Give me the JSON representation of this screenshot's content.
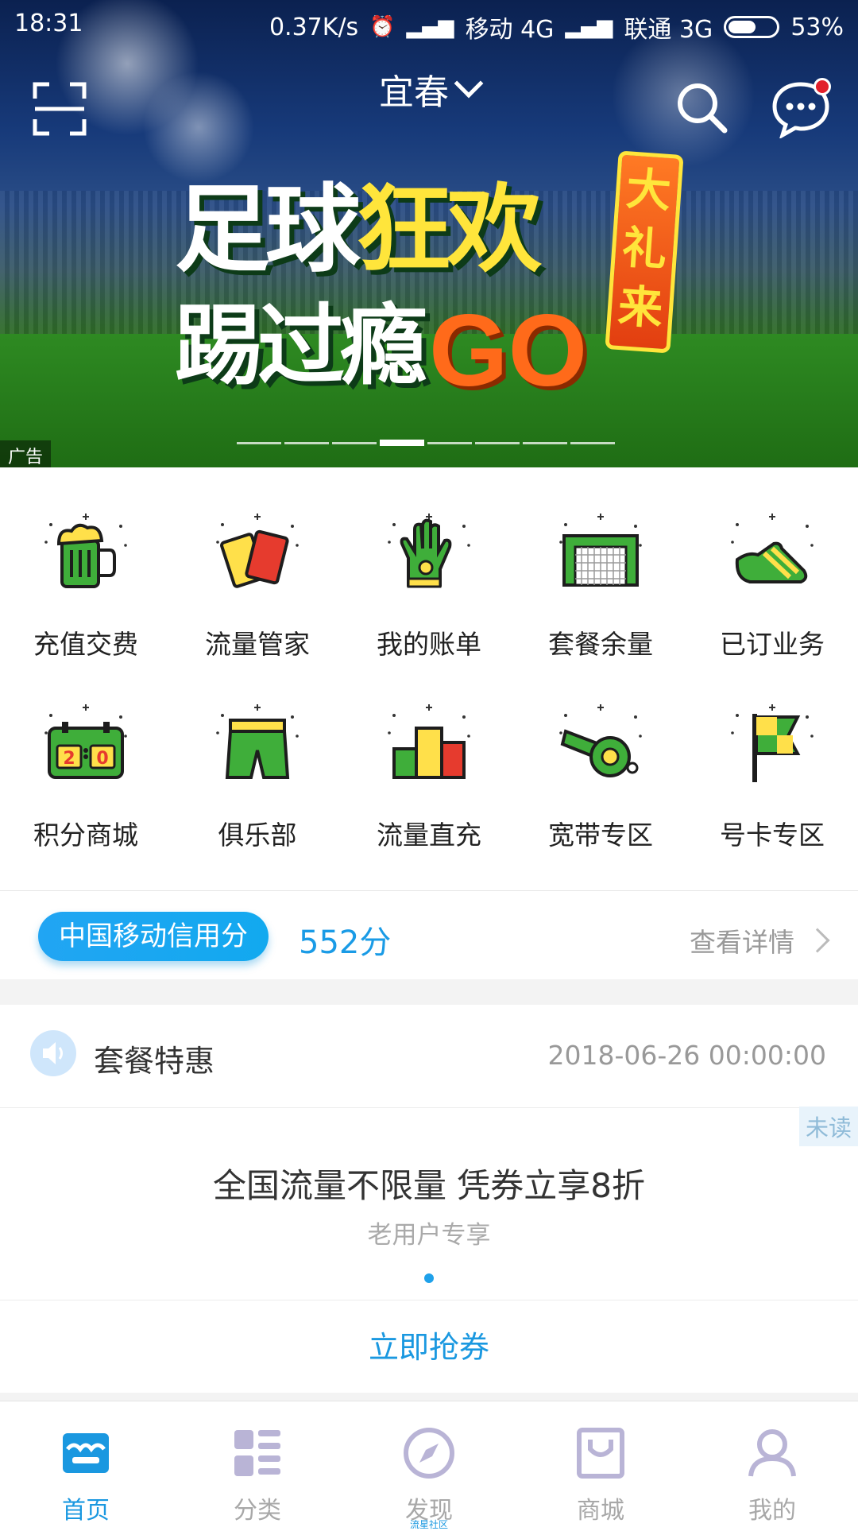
{
  "status_bar": {
    "time": "18:31",
    "speed": "0.37K/s",
    "carrier1": "移动 4G",
    "carrier2": "联通 3G",
    "battery": "53%"
  },
  "header": {
    "city": "宜春",
    "icons": [
      "scan-icon",
      "search-icon",
      "message-icon"
    ]
  },
  "banner": {
    "line1_white": "足球",
    "line1_yellow": "狂欢",
    "line2": "踢过瘾",
    "go": "GO",
    "badge": "大礼来",
    "ad_tag": "广告",
    "page_count": 8,
    "active_index": 3
  },
  "grid": [
    {
      "label": "充值交费",
      "icon": "beer-mug-icon"
    },
    {
      "label": "流量管家",
      "icon": "cards-icon"
    },
    {
      "label": "我的账单",
      "icon": "goalkeeper-glove-icon"
    },
    {
      "label": "套餐余量",
      "icon": "goal-net-icon"
    },
    {
      "label": "已订业务",
      "icon": "football-boot-icon"
    },
    {
      "label": "积分商城",
      "icon": "scoreboard-icon"
    },
    {
      "label": "俱乐部",
      "icon": "shorts-icon"
    },
    {
      "label": "流量直充",
      "icon": "podium-icon"
    },
    {
      "label": "宽带专区",
      "icon": "whistle-icon"
    },
    {
      "label": "号卡专区",
      "icon": "corner-flag-icon"
    }
  ],
  "credit": {
    "pill": "中国移动信用分",
    "score": "552分",
    "detail": "查看详情"
  },
  "notice": {
    "title": "套餐特惠",
    "time": "2018-06-26 00:00:00",
    "unread": "未读",
    "promo_title": "全国流量不限量 凭券立享8折",
    "promo_sub": "老用户专享",
    "cta": "立即抢券"
  },
  "bottom_nav": [
    {
      "label": "首页",
      "active": true
    },
    {
      "label": "分类",
      "active": false
    },
    {
      "label": "发现",
      "active": false,
      "sub": "流星社区"
    },
    {
      "label": "商城",
      "active": false
    },
    {
      "label": "我的",
      "active": false
    }
  ],
  "colors": {
    "accent": "#1a98e0",
    "badge_red": "#e2202b"
  }
}
